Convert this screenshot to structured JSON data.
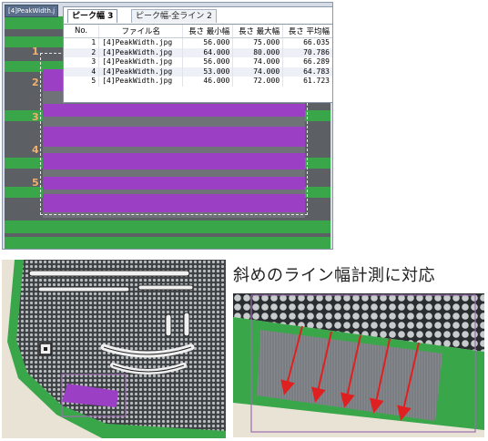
{
  "image_tab": {
    "label": "[4]PeakWidth.j"
  },
  "results_tabs": [
    {
      "label": "ピーク幅 3"
    },
    {
      "label": "ピーク幅-全ライン 2"
    }
  ],
  "table": {
    "headers": [
      "No.",
      "ファイル名",
      "長さ  最小幅",
      "長さ  最大幅",
      "長さ  平均幅"
    ],
    "rows": [
      [
        "1",
        "[4]PeakWidth.jpg",
        "56.000",
        "75.000",
        "66.035"
      ],
      [
        "2",
        "[4]PeakWidth.jpg",
        "64.000",
        "80.000",
        "70.786"
      ],
      [
        "3",
        "[4]PeakWidth.jpg",
        "56.000",
        "74.000",
        "66.289"
      ],
      [
        "4",
        "[4]PeakWidth.jpg",
        "53.000",
        "74.000",
        "64.783"
      ],
      [
        "5",
        "[4]PeakWidth.jpg",
        "46.000",
        "72.000",
        "61.723"
      ]
    ]
  },
  "line_labels": [
    "1",
    "2",
    "3",
    "4",
    "5"
  ],
  "caption": "斜めのライン幅計測に対応",
  "colors": {
    "measured_line": "#9b3fc4",
    "green_region": "#3aa64a",
    "gray_region": "#6f7377",
    "roi_box": "#9b6db0",
    "arrow": "#e02020"
  }
}
